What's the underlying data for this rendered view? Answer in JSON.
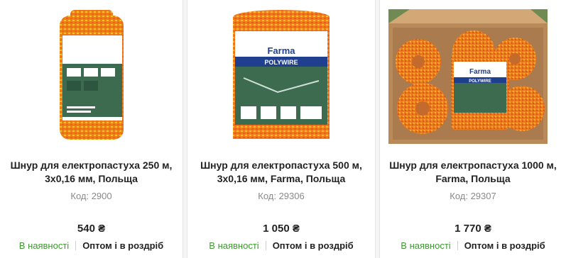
{
  "products": [
    {
      "title": "Шнур для електропастуха 250 м, 3х0,16 мм, Польща",
      "code": "Код: 2900",
      "price": "540 ₴",
      "stock": "В наявності",
      "sale": "Оптом і в роздріб"
    },
    {
      "title": "Шнур для електропастуха 500 м, 3х0,16 мм, Farma, Польща",
      "code": "Код: 29306",
      "price": "1 050 ₴",
      "stock": "В наявності",
      "sale": "Оптом і в роздріб",
      "image_brand": "Farma",
      "image_label": "POLYWIRE"
    },
    {
      "title": "Шнур для електропастуха 1000 м, Farma, Польща",
      "code": "Код: 29307",
      "price": "1 770 ₴",
      "stock": "В наявності",
      "sale": "Оптом і в роздріб",
      "image_brand": "Farma",
      "image_label": "POLYWIRE"
    }
  ],
  "colors": {
    "stock_green": "#3c9a2e",
    "wire_orange": "#f08a1c",
    "label_blue": "#1f3f8f",
    "label_green": "#3d6b4f"
  }
}
